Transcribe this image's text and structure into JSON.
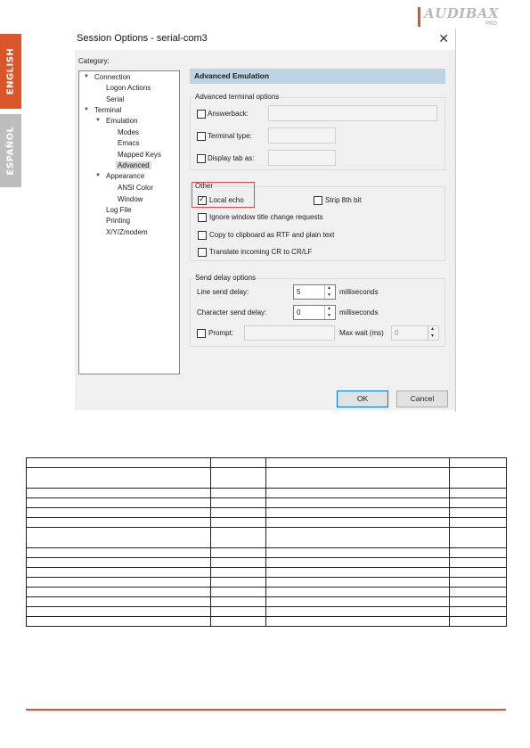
{
  "brand": {
    "logo": "AUDIBAX",
    "logo_sub": "PRO"
  },
  "language_tabs": [
    "ENGLISH",
    "ESPAÑOL"
  ],
  "dialog": {
    "title": "Session Options - serial-com3",
    "close_glyph": "✕",
    "category_label": "Category:",
    "tree": [
      {
        "label": "Connection",
        "expanded": true
      },
      {
        "label": "Logon Actions"
      },
      {
        "label": "Serial"
      },
      {
        "label": "Terminal",
        "expanded": true
      },
      {
        "label": "Emulation",
        "expanded": true
      },
      {
        "label": "Modes"
      },
      {
        "label": "Emacs"
      },
      {
        "label": "Mapped Keys"
      },
      {
        "label": "Advanced",
        "selected": true
      },
      {
        "label": "Appearance",
        "expanded": true
      },
      {
        "label": "ANSI Color"
      },
      {
        "label": "Window"
      },
      {
        "label": "Log File"
      },
      {
        "label": "Printing"
      },
      {
        "label": "X/Y/Zmodem"
      }
    ],
    "panel_title": "Advanced Emulation",
    "terminal_options": {
      "group_label": "Advanced terminal options",
      "answerback": {
        "label": "Answerback:",
        "checked": false,
        "value": ""
      },
      "terminal_type": {
        "label": "Terminal type:",
        "checked": false,
        "value": ""
      },
      "display_tab": {
        "label": "Display tab as:",
        "checked": false,
        "value": ""
      }
    },
    "other": {
      "group_label": "Other",
      "local_echo": {
        "label": "Local echo",
        "checked": true
      },
      "strip_8th_bit": {
        "label": "Strip 8th bit",
        "checked": false
      },
      "ignore_title": {
        "label": "Ignore window title change requests",
        "checked": false
      },
      "copy_rtf": {
        "label": "Copy to clipboard as RTF and plain text",
        "checked": false
      },
      "translate_cr": {
        "label": "Translate incoming CR to CR/LF",
        "checked": false
      }
    },
    "send_delay": {
      "group_label": "Send delay options",
      "line_label": "Line send delay:",
      "line_value": "5",
      "line_unit": "milliseconds",
      "char_label": "Character send delay:",
      "char_value": "0",
      "char_unit": "milliseconds",
      "prompt": {
        "label": "Prompt:",
        "checked": false,
        "value": ""
      },
      "max_wait_label": "Max wait (ms)",
      "max_wait_value": "0"
    },
    "ok_label": "OK",
    "cancel_label": "Cancel"
  },
  "colors": {
    "accent": "#d9562a",
    "panel_header": "#bcd4e4",
    "highlight": "#e0484f",
    "tab_inactive": "#bdbdbd"
  },
  "table": {
    "columns": 4,
    "rows": 15,
    "tall_rows": [
      1,
      6
    ]
  }
}
